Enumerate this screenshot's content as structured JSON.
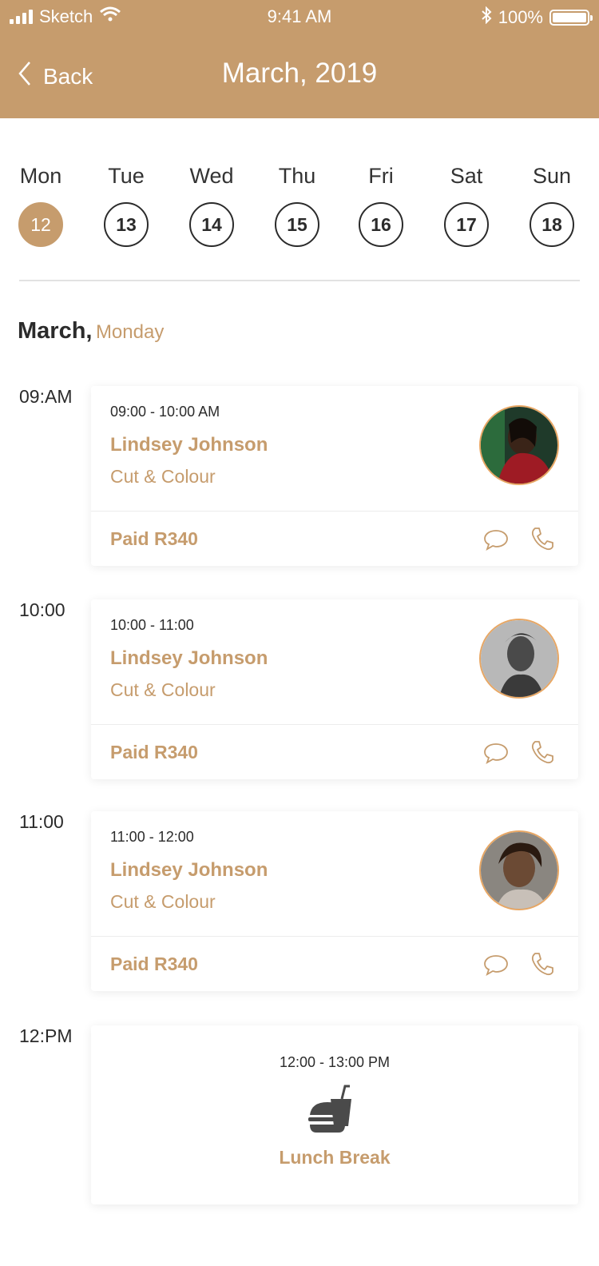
{
  "status_bar": {
    "carrier": "Sketch",
    "time": "9:41 AM",
    "battery": "100%"
  },
  "nav": {
    "back_label": "Back",
    "title": "March, 2019"
  },
  "week": [
    {
      "name": "Mon",
      "num": "12",
      "active": true
    },
    {
      "name": "Tue",
      "num": "13",
      "active": false
    },
    {
      "name": "Wed",
      "num": "14",
      "active": false
    },
    {
      "name": "Thu",
      "num": "15",
      "active": false
    },
    {
      "name": "Fri",
      "num": "16",
      "active": false
    },
    {
      "name": "Sat",
      "num": "17",
      "active": false
    },
    {
      "name": "Sun",
      "num": "18",
      "active": false
    }
  ],
  "date_label": {
    "month": "March,",
    "weekday": "Monday"
  },
  "appointments": [
    {
      "slot": "09:AM",
      "range": "09:00 - 10:00 AM",
      "client": "Lindsey Johnson",
      "service": "Cut & Colour",
      "paid": "Paid R340"
    },
    {
      "slot": "10:00",
      "range": "10:00 - 11:00",
      "client": "Lindsey Johnson",
      "service": "Cut & Colour",
      "paid": "Paid R340"
    },
    {
      "slot": "11:00",
      "range": "11:00 - 12:00",
      "client": "Lindsey Johnson",
      "service": "Cut & Colour",
      "paid": "Paid R340"
    }
  ],
  "lunch": {
    "slot": "12:PM",
    "range": "12:00 - 13:00 PM",
    "label": "Lunch Break",
    "icon": "burger-drink-icon"
  },
  "colors": {
    "accent": "#c69c6d",
    "avatar_ring": "#e8a764",
    "text": "#2b2b2b"
  }
}
